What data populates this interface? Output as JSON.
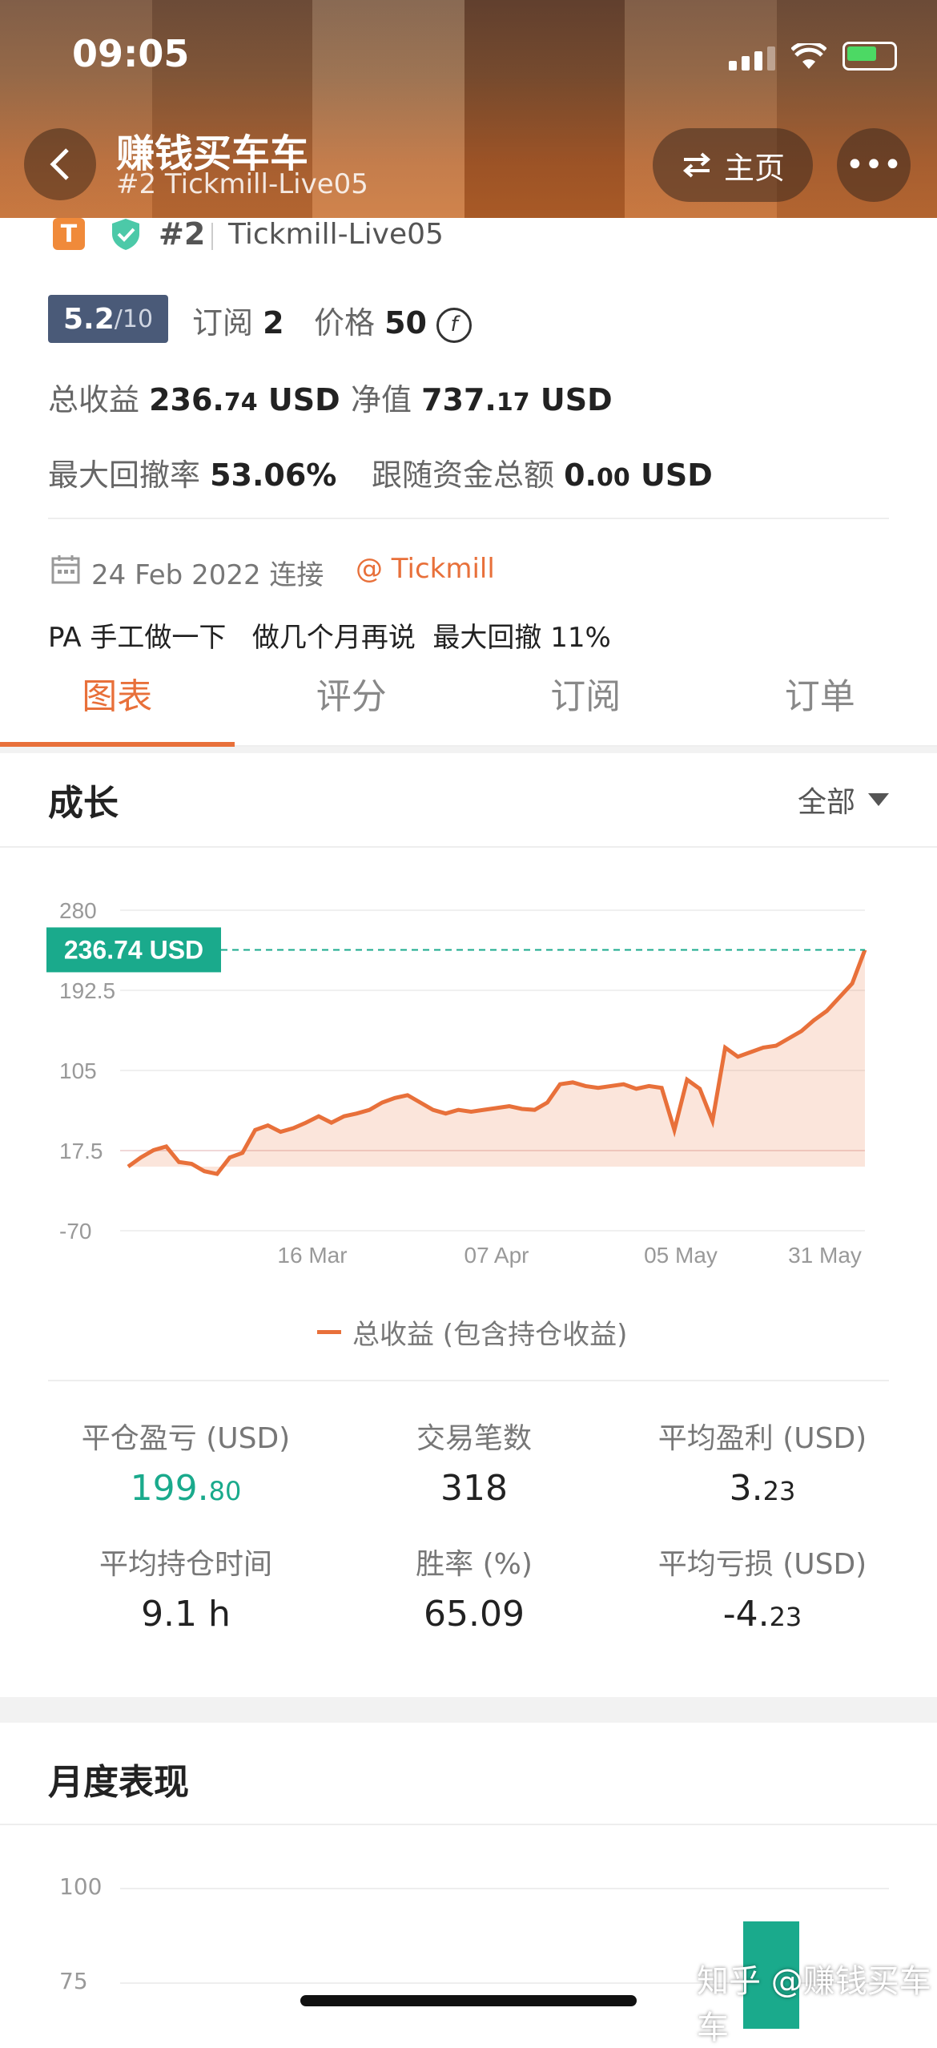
{
  "status": {
    "time": "09:05"
  },
  "header": {
    "title": "赚钱买车车",
    "subtitle": "#2 Tickmill-Live05",
    "home_label": "主页"
  },
  "account": {
    "badge": "T",
    "rank": "#2",
    "name": "Tickmill-Live05",
    "rating_value": "5.2",
    "rating_max": "/10",
    "subscribe_label": "订阅",
    "subscribe_count": "2",
    "price_label": "价格",
    "price_value": "50",
    "total_profit_label": "总收益",
    "total_profit_int": "236.",
    "total_profit_dec": "74",
    "total_profit_unit": "USD",
    "equity_label": "净值",
    "equity_int": "737.",
    "equity_dec": "17",
    "equity_unit": "USD",
    "max_dd_label": "最大回撤率",
    "max_dd_value": "53.06%",
    "follow_label": "跟随资金总额",
    "follow_int": "0.",
    "follow_dec": "00",
    "follow_unit": "USD",
    "connect_date": "24 Feb 2022 连接",
    "broker": "@ Tickmill",
    "description": "PA 手工做一下   做几个月再说  最大回撤 11%"
  },
  "tabs": [
    "图表",
    "评分",
    "订阅",
    "订单"
  ],
  "growth": {
    "title": "成长",
    "filter": "全部",
    "legend": "总收益 (包含持仓收益)"
  },
  "chart_data": {
    "type": "area",
    "yticks": [
      "280",
      "192.5",
      "105",
      "17.5",
      "-70"
    ],
    "ylim": [
      -70,
      280
    ],
    "xticks": [
      "16 Mar",
      "07 Apr",
      "05 May",
      "31 May"
    ],
    "current_label": "236.74 USD",
    "current_value": 236.74,
    "series": [
      {
        "values": [
          0,
          10,
          18,
          22,
          5,
          3,
          -5,
          -8,
          10,
          15,
          40,
          45,
          38,
          42,
          48,
          55,
          48,
          55,
          58,
          62,
          70,
          75,
          78,
          70,
          62,
          58,
          62,
          60,
          62,
          64,
          66,
          63,
          62,
          70,
          90,
          92,
          88,
          86,
          88,
          90,
          85,
          88,
          86,
          40,
          95,
          85,
          50,
          130,
          120,
          125,
          130,
          132,
          140,
          148,
          160,
          170,
          185,
          200,
          236.74
        ]
      }
    ]
  },
  "stats": [
    {
      "label": "平仓盈亏 (USD)",
      "int": "199.",
      "dec": "80",
      "green": true
    },
    {
      "label": "交易笔数",
      "int": "318",
      "dec": "",
      "green": false
    },
    {
      "label": "平均盈利 (USD)",
      "int": "3.",
      "dec": "23",
      "green": false
    },
    {
      "label": "平均持仓时间",
      "int": "9.1 h",
      "dec": "",
      "green": false
    },
    {
      "label": "胜率 (%)",
      "int": "65.09",
      "dec": "",
      "green": false
    },
    {
      "label": "平均亏损 (USD)",
      "int": "-4.",
      "dec": "23",
      "green": false
    }
  ],
  "monthly": {
    "title": "月度表现",
    "yticks": [
      "100",
      "75"
    ]
  },
  "watermark": "知乎 @赚钱买车车",
  "colors": {
    "accent": "#e8703a",
    "green": "#1aaa8c",
    "rating_bg": "#4a5a78"
  }
}
